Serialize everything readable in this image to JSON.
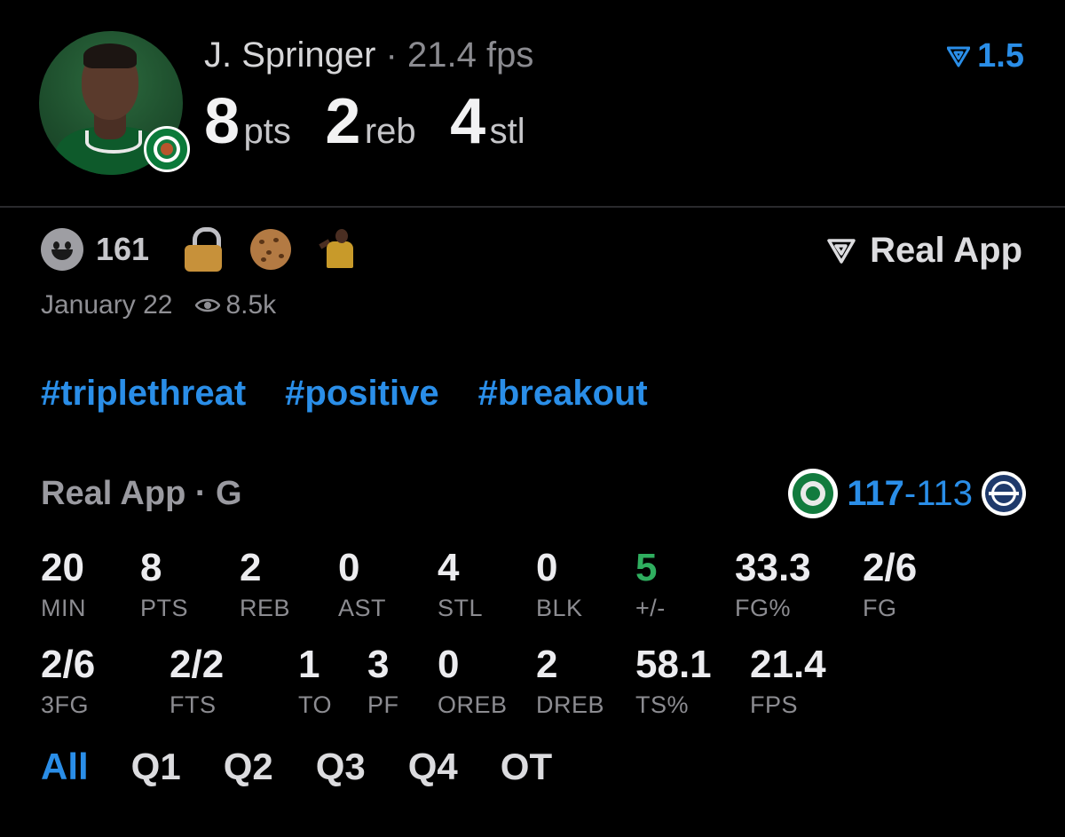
{
  "player": {
    "name": "J. Springer",
    "separator": "·",
    "fps": "21.4 fps",
    "stats": [
      {
        "value": "8",
        "label": "pts"
      },
      {
        "value": "2",
        "label": "reb"
      },
      {
        "value": "4",
        "label": "stl"
      }
    ],
    "rating": "1.5"
  },
  "social": {
    "reaction_count": "161",
    "date": "January 22",
    "views": "8.5k",
    "brand": "Real App"
  },
  "tags": [
    "#triplethreat",
    "#positive",
    "#breakout"
  ],
  "game": {
    "title": "Real App · G",
    "score_team": "117",
    "score_dash": "-",
    "score_opp": "113"
  },
  "box_row1": [
    {
      "value": "20",
      "label": "MIN"
    },
    {
      "value": "8",
      "label": "PTS"
    },
    {
      "value": "2",
      "label": "REB"
    },
    {
      "value": "0",
      "label": "AST"
    },
    {
      "value": "4",
      "label": "STL"
    },
    {
      "value": "0",
      "label": "BLK"
    },
    {
      "value": "5",
      "label": "+/-"
    },
    {
      "value": "33.3",
      "label": "FG%"
    },
    {
      "value": "2/6",
      "label": "FG"
    }
  ],
  "box_row2": [
    {
      "value": "2/6",
      "label": "3FG"
    },
    {
      "value": "2/2",
      "label": "FTS"
    },
    {
      "value": "1",
      "label": "TO"
    },
    {
      "value": "3",
      "label": "PF"
    },
    {
      "value": "0",
      "label": "OREB"
    },
    {
      "value": "2",
      "label": "DREB"
    },
    {
      "value": "58.1",
      "label": "TS%"
    },
    {
      "value": "21.4",
      "label": "FPS"
    }
  ],
  "periods": [
    "All",
    "Q1",
    "Q2",
    "Q3",
    "Q4",
    "OT"
  ],
  "colors": {
    "accent": "#2a8ee8",
    "positive": "#2fae5f",
    "background": "#000000"
  }
}
